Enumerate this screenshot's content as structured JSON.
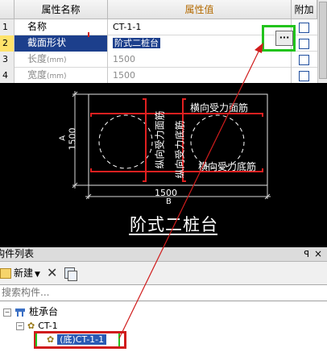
{
  "grid": {
    "col_name": "属性名称",
    "col_value": "属性值",
    "col_attach": "附加",
    "rows": [
      {
        "num": "1",
        "name": "名称",
        "unit": "",
        "value": "CT-1-1"
      },
      {
        "num": "2",
        "name": "截面形状",
        "unit": "",
        "value": "阶式二桩台"
      },
      {
        "num": "3",
        "name": "长度",
        "unit": "(mm)",
        "value": "1500"
      },
      {
        "num": "4",
        "name": "宽度",
        "unit": "(mm)",
        "value": "1500"
      }
    ],
    "ellipsis": "···"
  },
  "drawing": {
    "title": "阶式二桩台",
    "label_h_top": "横向受力面筋",
    "label_h_bottom": "横向受力底筋",
    "label_v_top": "纵向受力面筋",
    "label_v_bottom": "纵向受力底筋",
    "dim_bottom_value": "1500",
    "dim_bottom_name": "B",
    "dim_left_value": "1500",
    "dim_left_name": "A"
  },
  "panel": {
    "title": "构件列表",
    "pin": "ㅁ",
    "close": "×",
    "new_label": "新建",
    "dropdown": "▼",
    "delete_glyph": "✕",
    "search_placeholder": "搜索构件...",
    "tree": {
      "root": "桩承台",
      "child": "CT-1",
      "leaf": "(底)CT-1-1"
    }
  },
  "colors": {
    "annotation": "#d01c1c",
    "highlight_green": "#22c31c",
    "selection": "#2a5ab4"
  }
}
